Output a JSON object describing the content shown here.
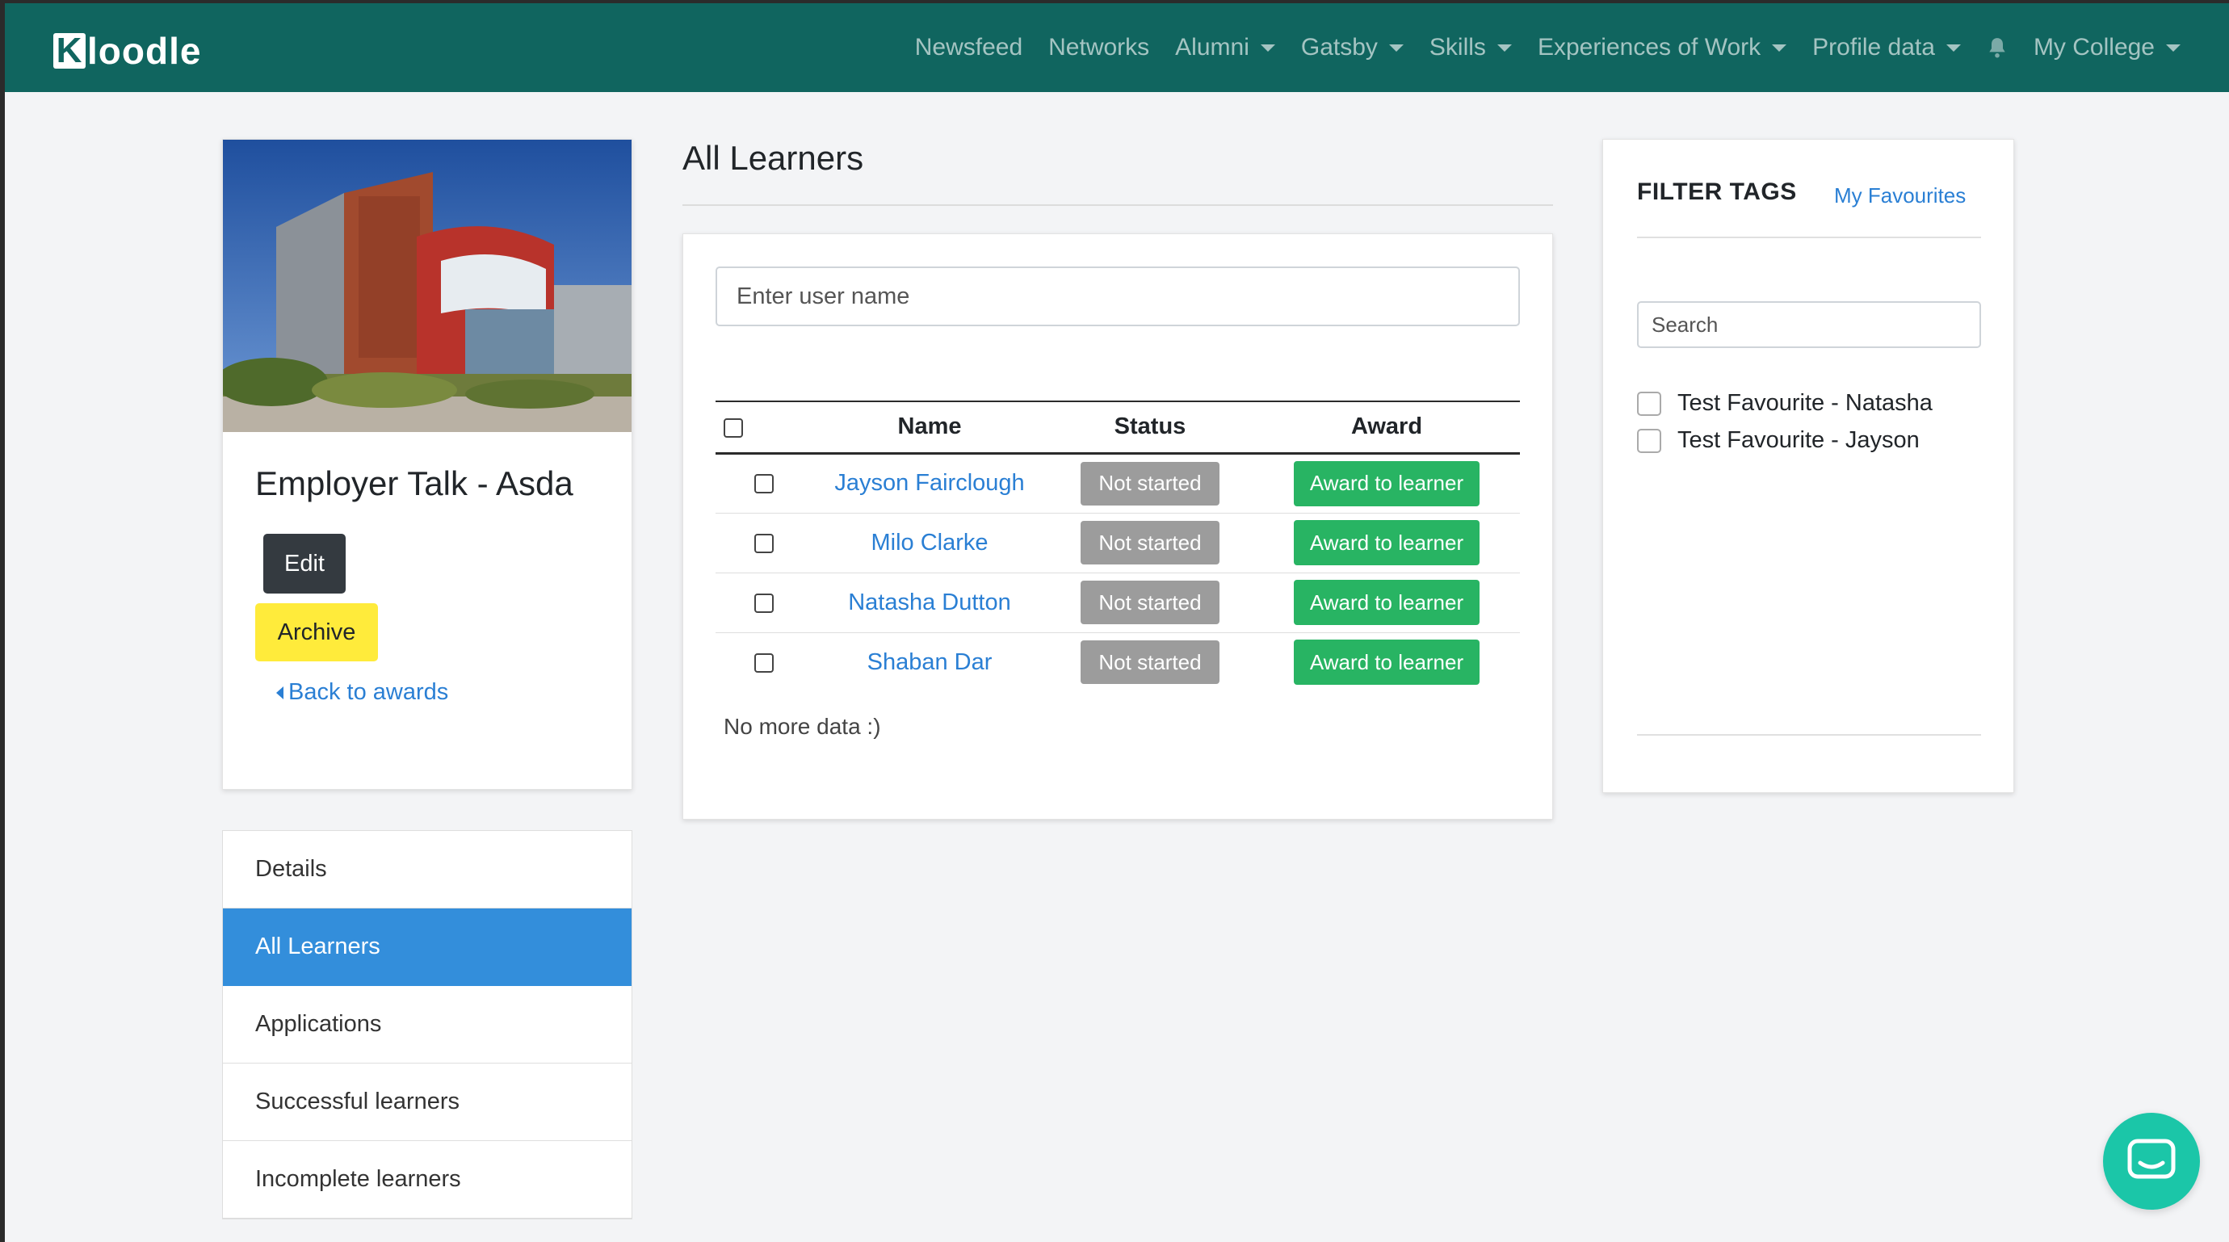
{
  "navbar": {
    "logo_letter": "K",
    "logo_rest": "loodle",
    "items": [
      {
        "label": "Newsfeed",
        "dropdown": false
      },
      {
        "label": "Networks",
        "dropdown": false
      },
      {
        "label": "Alumni",
        "dropdown": true
      },
      {
        "label": "Gatsby",
        "dropdown": true
      },
      {
        "label": "Skills",
        "dropdown": true
      },
      {
        "label": "Experiences of Work",
        "dropdown": true
      },
      {
        "label": "Profile data",
        "dropdown": true
      }
    ],
    "bell_icon": "bell-icon",
    "account_label": "My College"
  },
  "event": {
    "title": "Employer Talk - Asda",
    "edit_label": "Edit",
    "archive_label": "Archive",
    "back_label": "Back to awards"
  },
  "side_menu": {
    "items": [
      "Details",
      "All Learners",
      "Applications",
      "Successful learners",
      "Incomplete learners"
    ],
    "active": "All Learners"
  },
  "main": {
    "title": "All Learners",
    "search_placeholder": "Enter user name",
    "columns": {
      "name": "Name",
      "status": "Status",
      "award": "Award"
    },
    "rows": [
      {
        "name": "Jayson Fairclough",
        "status": "Not started",
        "award": "Award to learner"
      },
      {
        "name": "Milo Clarke",
        "status": "Not started",
        "award": "Award to learner"
      },
      {
        "name": "Natasha Dutton",
        "status": "Not started",
        "award": "Award to learner"
      },
      {
        "name": "Shaban Dar",
        "status": "Not started",
        "award": "Award to learner"
      }
    ],
    "no_more": "No more data :)"
  },
  "filter": {
    "title": "FILTER TAGS",
    "favourites_label": "My Favourites",
    "search_placeholder": "Search",
    "tags": [
      "Test Favourite - Natasha",
      "Test Favourite - Jayson"
    ]
  },
  "colors": {
    "navbar": "#10655f",
    "link": "#2a7fd4",
    "active_menu": "#338edb",
    "award_button": "#28b463",
    "status_badge": "#9c9c9c",
    "archive_button": "#ffeb3b",
    "chat_bubble": "#1bc6a8"
  }
}
